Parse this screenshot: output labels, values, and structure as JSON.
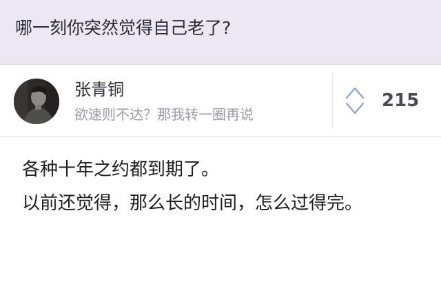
{
  "question": {
    "title": "哪一刻你突然觉得自己老了?"
  },
  "author": {
    "name": "张青铜",
    "bio": "欲速则不达？那我转一圈再说",
    "avatar_icon": "person-avatar-icon"
  },
  "votes": {
    "count": "215",
    "icon": "vote-up-down-arrows-icon"
  },
  "answer": {
    "paragraphs": [
      "各种十年之约都到期了。",
      "以前还觉得，那么长的时间，怎么过得完。"
    ]
  },
  "colors": {
    "question_bg": "#ece8f3",
    "bio_text": "#9c9ca4",
    "body_text": "#1e1e24"
  }
}
